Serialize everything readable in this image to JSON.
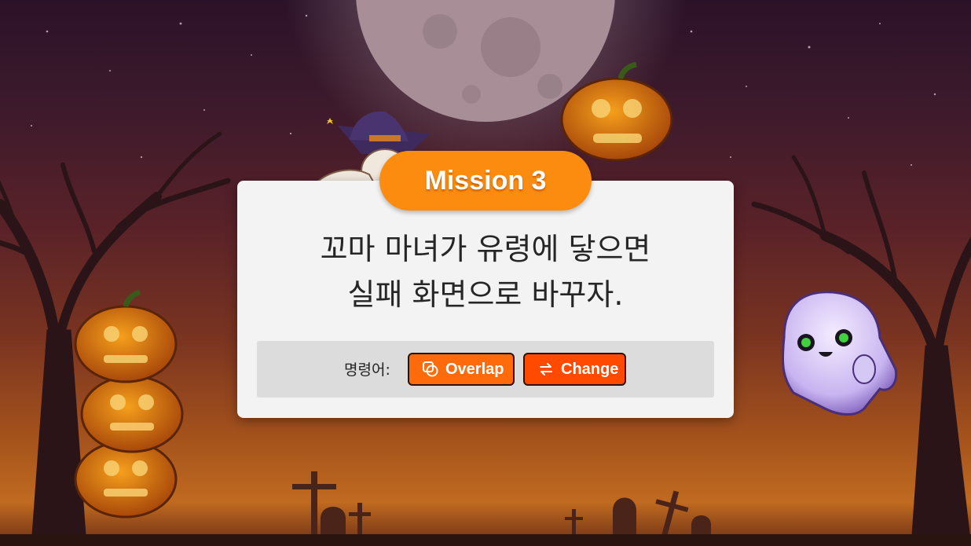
{
  "mission": {
    "badge": "Mission 3",
    "line1": "꼬마 마녀가 유령에 닿으면",
    "line2": "실패 화면으로 바꾸자."
  },
  "commands": {
    "label": "명령어:",
    "buttons": [
      {
        "label": "Overlap",
        "icon": "overlap-icon"
      },
      {
        "label": "Change",
        "icon": "change-icon"
      }
    ]
  },
  "colors": {
    "badge": "#fb8c10",
    "overlap_button": "#ff6a0a",
    "change_button": "#ff4a00",
    "panel": "#f4f3f3"
  }
}
